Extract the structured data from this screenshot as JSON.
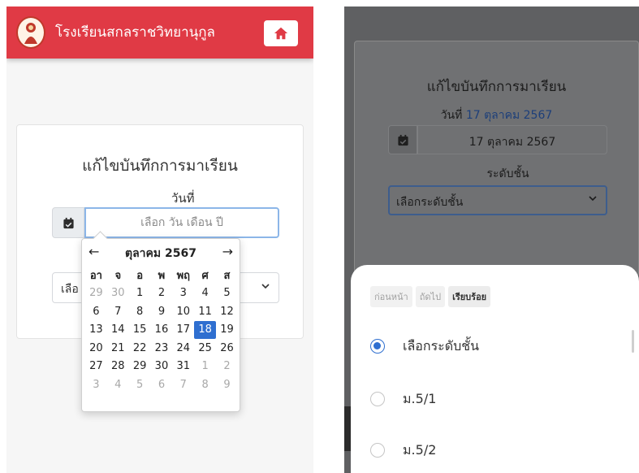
{
  "left": {
    "school_name": "โรงเรียนสกลราชวิทยานุกูล",
    "card_title": "แก้ไขบันทึกการมาเรียน",
    "date_label": "วันที่",
    "date_placeholder": "เลือก วัน เดือน ปี",
    "select_partial": "เลือ",
    "calendar": {
      "prev": "←",
      "next": "→",
      "month": "ตุลาคม 2567",
      "weekdays": [
        "อา",
        "จ",
        "อ",
        "พ",
        "พฤ",
        "ศ",
        "ส"
      ],
      "weeks": [
        [
          "29",
          "30",
          "1",
          "2",
          "3",
          "4",
          "5"
        ],
        [
          "6",
          "7",
          "8",
          "9",
          "10",
          "11",
          "12"
        ],
        [
          "13",
          "14",
          "15",
          "16",
          "17",
          "18",
          "19"
        ],
        [
          "20",
          "21",
          "22",
          "23",
          "24",
          "25",
          "26"
        ],
        [
          "27",
          "28",
          "29",
          "30",
          "31",
          "1",
          "2"
        ],
        [
          "3",
          "4",
          "5",
          "6",
          "7",
          "8",
          "9"
        ]
      ],
      "selected_day": "18"
    }
  },
  "right": {
    "card_title": "แก้ไขบันทึกการมาเรียน",
    "date_prefix": "วันที่",
    "date_highlight": "17 ตุลาคม 2567",
    "date_value": "17 ตุลาคม 2567",
    "level_label": "ระดับชั้น",
    "select_value": "เลือกระดับชั้น",
    "sheet": {
      "prev": "ก่อนหน้า",
      "next": "ถัดไป",
      "done": "เรียบร้อย",
      "options": [
        {
          "label": "เลือกระดับชั้น",
          "selected": true
        },
        {
          "label": "ม.5/1",
          "selected": false
        },
        {
          "label": "ม.5/2",
          "selected": false
        }
      ]
    }
  },
  "colors": {
    "topbar": "#e03a45",
    "accent": "#2f6fd0",
    "overlay": "#5f6062"
  },
  "icons": [
    "school-logo-icon",
    "home-icon",
    "calendar-check-icon",
    "chevron-down-icon",
    "arrow-left-icon",
    "arrow-right-icon",
    "radio-icon"
  ]
}
